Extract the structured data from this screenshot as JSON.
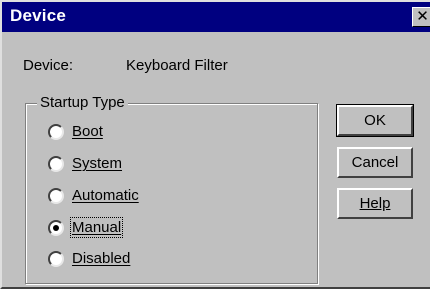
{
  "window": {
    "title": "Device",
    "close_glyph": "✕"
  },
  "device": {
    "label": "Device:",
    "value": "Keyboard Filter"
  },
  "startup_type": {
    "group_label": "Startup Type",
    "options": [
      {
        "label": "Boot",
        "selected": false
      },
      {
        "label": "System",
        "selected": false
      },
      {
        "label": "Automatic",
        "selected": false
      },
      {
        "label": "Manual",
        "selected": true
      },
      {
        "label": "Disabled",
        "selected": false
      }
    ]
  },
  "buttons": {
    "ok": "OK",
    "cancel": "Cancel",
    "help": "Help"
  },
  "colors": {
    "titlebar": "#000080",
    "face": "#c0c0c0"
  }
}
